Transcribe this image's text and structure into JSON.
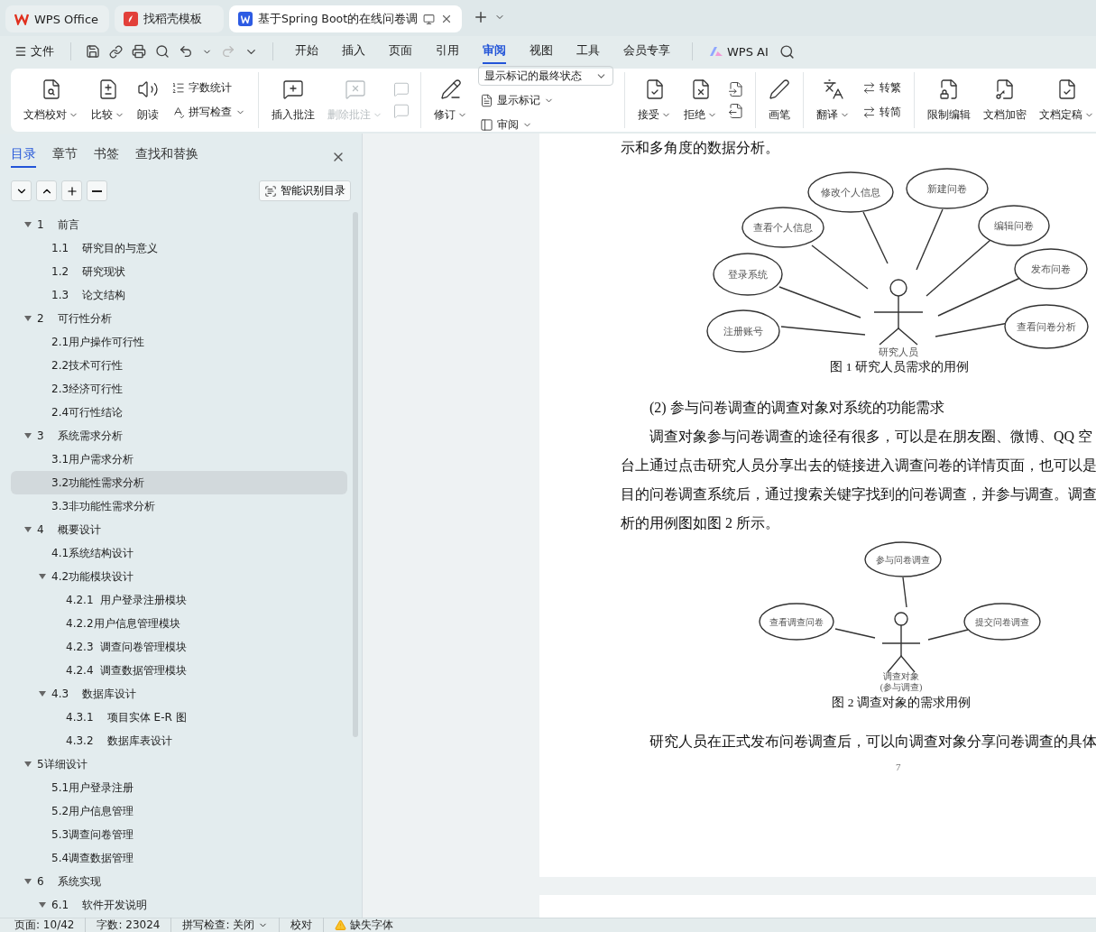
{
  "app_tabs": [
    {
      "kind": "home",
      "label": "WPS Office",
      "selected": false
    },
    {
      "kind": "template",
      "label": "找稻壳模板",
      "selected": false
    },
    {
      "kind": "document",
      "label": "基于Spring Boot的在线问卷调",
      "selected": true
    }
  ],
  "menu": {
    "file": "文件",
    "ribbon_tabs": [
      {
        "label": "开始",
        "selected": false
      },
      {
        "label": "插入",
        "selected": false
      },
      {
        "label": "页面",
        "selected": false
      },
      {
        "label": "引用",
        "selected": false
      },
      {
        "label": "审阅",
        "selected": true
      },
      {
        "label": "视图",
        "selected": false
      },
      {
        "label": "工具",
        "selected": false
      },
      {
        "label": "会员专享",
        "selected": false
      }
    ],
    "ai": "WPS AI"
  },
  "ribbon_groups": [
    {
      "items": [
        {
          "kind": "large",
          "label": "文档校对",
          "dropdown": true,
          "disabled": false
        },
        {
          "kind": "large",
          "label": "比较",
          "dropdown": true,
          "disabled": false
        },
        {
          "kind": "large",
          "label": "朗读",
          "dropdown": false,
          "disabled": false
        },
        {
          "kind": "stack",
          "items": [
            {
              "label": "字数统计",
              "dropdown": false,
              "disabled": false
            },
            {
              "label": "拼写检查",
              "dropdown": true,
              "disabled": false
            }
          ]
        }
      ]
    },
    {
      "items": [
        {
          "kind": "large",
          "label": "插入批注",
          "dropdown": false,
          "disabled": false
        },
        {
          "kind": "large",
          "label": "删除批注",
          "dropdown": true,
          "disabled": true
        },
        {
          "kind": "iconstack",
          "disabled": true
        }
      ]
    },
    {
      "items": [
        {
          "kind": "large",
          "label": "修订",
          "dropdown": true,
          "disabled": false
        },
        {
          "kind": "selectstack",
          "value": "显示标记的最终状态",
          "items": [
            {
              "label": "显示标记",
              "dropdown": true,
              "disabled": false
            },
            {
              "label": "审阅",
              "dropdown": true,
              "disabled": false
            }
          ]
        }
      ]
    },
    {
      "items": [
        {
          "kind": "large",
          "label": "接受",
          "dropdown": true,
          "disabled": false
        },
        {
          "kind": "large",
          "label": "拒绝",
          "dropdown": true,
          "disabled": false
        },
        {
          "kind": "iconstack",
          "disabled": false
        }
      ]
    },
    {
      "items": [
        {
          "kind": "large",
          "label": "画笔",
          "dropdown": false,
          "disabled": false
        }
      ]
    },
    {
      "items": [
        {
          "kind": "large",
          "label": "翻译",
          "dropdown": true,
          "disabled": false
        },
        {
          "kind": "stack",
          "items": [
            {
              "label": "转繁",
              "dropdown": false,
              "disabled": false
            },
            {
              "label": "转简",
              "dropdown": false,
              "disabled": false
            }
          ]
        }
      ]
    },
    {
      "items": [
        {
          "kind": "large",
          "label": "限制编辑",
          "dropdown": false,
          "disabled": false
        },
        {
          "kind": "large",
          "label": "文档加密",
          "dropdown": false,
          "disabled": false
        },
        {
          "kind": "large",
          "label": "文档定稿",
          "dropdown": true,
          "disabled": false
        }
      ]
    }
  ],
  "nav_panel": {
    "tabs": [
      {
        "label": "目录",
        "selected": true
      },
      {
        "label": "章节",
        "selected": false
      },
      {
        "label": "书签",
        "selected": false
      },
      {
        "label": "查找和替换",
        "selected": false
      }
    ],
    "smart_button": "智能识别目录",
    "toc": [
      {
        "label": "1    前言",
        "selected": false,
        "expanded": true,
        "children": [
          {
            "label": "1.1    研究目的与意义",
            "selected": false
          },
          {
            "label": "1.2    研究现状",
            "selected": false
          },
          {
            "label": "1.3    论文结构",
            "selected": false
          }
        ]
      },
      {
        "label": "2    可行性分析",
        "selected": false,
        "expanded": true,
        "children": [
          {
            "label": "2.1用户操作可行性",
            "selected": false
          },
          {
            "label": "2.2技术可行性",
            "selected": false
          },
          {
            "label": "2.3经济可行性",
            "selected": false
          },
          {
            "label": "2.4可行性结论",
            "selected": false
          }
        ]
      },
      {
        "label": "3    系统需求分析",
        "selected": false,
        "expanded": true,
        "children": [
          {
            "label": "3.1用户需求分析",
            "selected": false
          },
          {
            "label": "3.2功能性需求分析",
            "selected": true
          },
          {
            "label": "3.3非功能性需求分析",
            "selected": false
          }
        ]
      },
      {
        "label": "4    概要设计",
        "selected": false,
        "expanded": true,
        "children": [
          {
            "label": "4.1系统结构设计",
            "selected": false
          },
          {
            "label": "4.2功能模块设计",
            "selected": false,
            "expanded": true,
            "children": [
              {
                "label": "4.2.1  用户登录注册模块",
                "selected": false
              },
              {
                "label": "4.2.2用户信息管理模块",
                "selected": false
              },
              {
                "label": "4.2.3  调查问卷管理模块",
                "selected": false
              },
              {
                "label": "4.2.4  调查数据管理模块",
                "selected": false
              }
            ]
          },
          {
            "label": "4.3    数据库设计",
            "selected": false,
            "expanded": true,
            "children": [
              {
                "label": "4.3.1    项目实体 E-R 图",
                "selected": false
              },
              {
                "label": "4.3.2    数据库表设计",
                "selected": false
              }
            ]
          }
        ]
      },
      {
        "label": "5详细设计",
        "selected": false,
        "expanded": true,
        "children": [
          {
            "label": "5.1用户登录注册",
            "selected": false
          },
          {
            "label": "5.2用户信息管理",
            "selected": false
          },
          {
            "label": "5.3调查问卷管理",
            "selected": false
          },
          {
            "label": "5.4调查数据管理",
            "selected": false
          }
        ]
      },
      {
        "label": "6    系统实现",
        "selected": false,
        "expanded": true,
        "children": [
          {
            "label": "6.1    软件开发说明",
            "selected": false,
            "expanded": true
          }
        ]
      }
    ]
  },
  "document": {
    "top_line": "示和多角度的数据分析。",
    "figure_1": {
      "use_cases": [
        "修改个人信息",
        "新建问卷",
        "查看个人信息",
        "编辑问卷",
        "登录系统",
        "发布问卷",
        "注册账号",
        "查看问卷分析"
      ],
      "actor": "研究人员",
      "caption": "图 1  研究人员需求的用例"
    },
    "heading": "(2)  参与问卷调查的调查对象对系统的功能需求",
    "paragraph_lines": [
      "调查对象参与问卷调查的途径有很多，可以是在朋友圈、微博、QQ 空",
      "台上通过点击研究人员分享出去的链接进入调查问卷的详情页面，也可以是",
      "目的问卷调查系统后，通过搜索关键字找到的问卷调查，并参与调查。调查",
      "析的用例图如图 2 所示。"
    ],
    "figure_2": {
      "use_cases": [
        "参与问卷调查",
        "查看调查问卷",
        "提交问卷调查"
      ],
      "actor": [
        "调查对象",
        "(参与调查)"
      ],
      "caption": "图 2  调查对象的需求用例"
    },
    "last_line": "研究人员在正式发布问卷调查后，可以向调查对象分享问卷调查的具体",
    "page_number": "7"
  },
  "status_bar": {
    "page": "页面: 10/42",
    "words": "字数: 23024",
    "spell": "拼写检查: 关闭",
    "proof": "校对",
    "missing_font": "缺失字体"
  }
}
